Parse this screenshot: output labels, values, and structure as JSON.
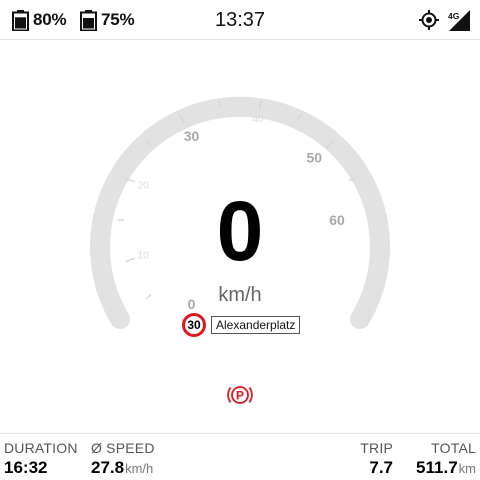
{
  "status": {
    "battery1": {
      "level": 80,
      "label": "80%"
    },
    "battery2": {
      "level": 75,
      "label": "75%"
    },
    "time": "13:37",
    "icons": [
      "battery-icon",
      "battery-icon",
      "gps-icon",
      "signal-4g-icon"
    ],
    "network_label": "4G"
  },
  "gauge": {
    "min": 0,
    "max": 60,
    "major_labels": [
      "0",
      "10",
      "20",
      "30",
      "40",
      "50",
      "60"
    ],
    "speed": "0",
    "unit": "km/h"
  },
  "road": {
    "speed_limit": "30",
    "street": "Alexanderplatz"
  },
  "parking_icon": "parking-brake-icon",
  "stats": {
    "duration": {
      "label": "DURATION",
      "value": "16:32"
    },
    "avg_speed": {
      "label": "Ø SPEED",
      "value": "27.8",
      "unit": "km/h"
    },
    "trip": {
      "label": "TRIP",
      "value": "7.7"
    },
    "total": {
      "label": "TOTAL",
      "value": "511.7",
      "unit": "km"
    }
  },
  "colors": {
    "arc": "#e2e2e2",
    "ticks": "#d6d6d6",
    "limit_ring": "#e0171f",
    "parking": "#e0171f"
  }
}
